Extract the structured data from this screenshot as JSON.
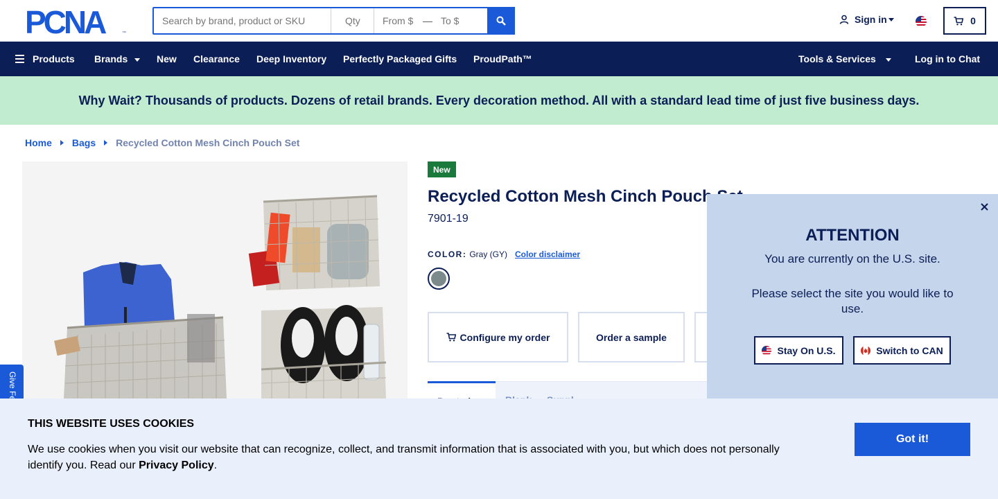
{
  "header": {
    "logo_text": "PCNA",
    "search": {
      "keyword_placeholder": "Search by brand, product or SKU",
      "qty_placeholder": "Qty",
      "from_placeholder": "From $",
      "separator": "—",
      "to_placeholder": "To $"
    },
    "sign_in_label": "Sign in",
    "cart_count": "0",
    "colors": {
      "brand_blue": "#1a5ad8",
      "navy": "#0b1e56"
    }
  },
  "nav": {
    "items": [
      {
        "label": "Products",
        "icon": "hamburger-icon"
      },
      {
        "label": "Brands",
        "has_dropdown": true
      },
      {
        "label": "New"
      },
      {
        "label": "Clearance"
      },
      {
        "label": "Deep Inventory"
      },
      {
        "label": "Perfectly Packaged Gifts"
      },
      {
        "label": "ProudPath™"
      }
    ],
    "tools_label": "Tools & Services",
    "chat_label": "Log in to Chat"
  },
  "banner": {
    "text": "Why Wait? Thousands of products. Dozens of retail brands. Every decoration method. All with a standard lead time of just five business days.",
    "bg_color": "#c2eccf"
  },
  "breadcrumb": {
    "items": [
      "Home",
      "Bags"
    ],
    "current": "Recycled Cotton Mesh Cinch Pouch Set"
  },
  "product": {
    "badge": "New",
    "title": "Recycled Cotton Mesh Cinch Pouch Set",
    "sku": "7901-19",
    "color_label": "COLOR:",
    "color_value": "Gray (GY)",
    "color_disclaimer": "Color disclaimer",
    "swatch_color": "#7d8a8c",
    "actions": {
      "configure": "Configure my order",
      "sample": "Order a sample"
    },
    "tabs": {
      "first": "Pro ted",
      "second": "Blank — Suppl"
    }
  },
  "site_modal": {
    "heading": "ATTENTION",
    "message1": "You are currently on the U.S. site.",
    "message2": "Please select the site you would like to use.",
    "stay_label": "Stay On U.S.",
    "switch_label": "Switch to CAN"
  },
  "feedback_label": "Give Fe",
  "cookie": {
    "heading": "THIS WEBSITE USES COOKIES",
    "text": "We use cookies when you visit our website that can recognize, collect, and transmit information that is associated with you, but which does not personally identify you. Read our",
    "policy_link": "Privacy Policy",
    "period": ".",
    "button": "Got it!"
  }
}
